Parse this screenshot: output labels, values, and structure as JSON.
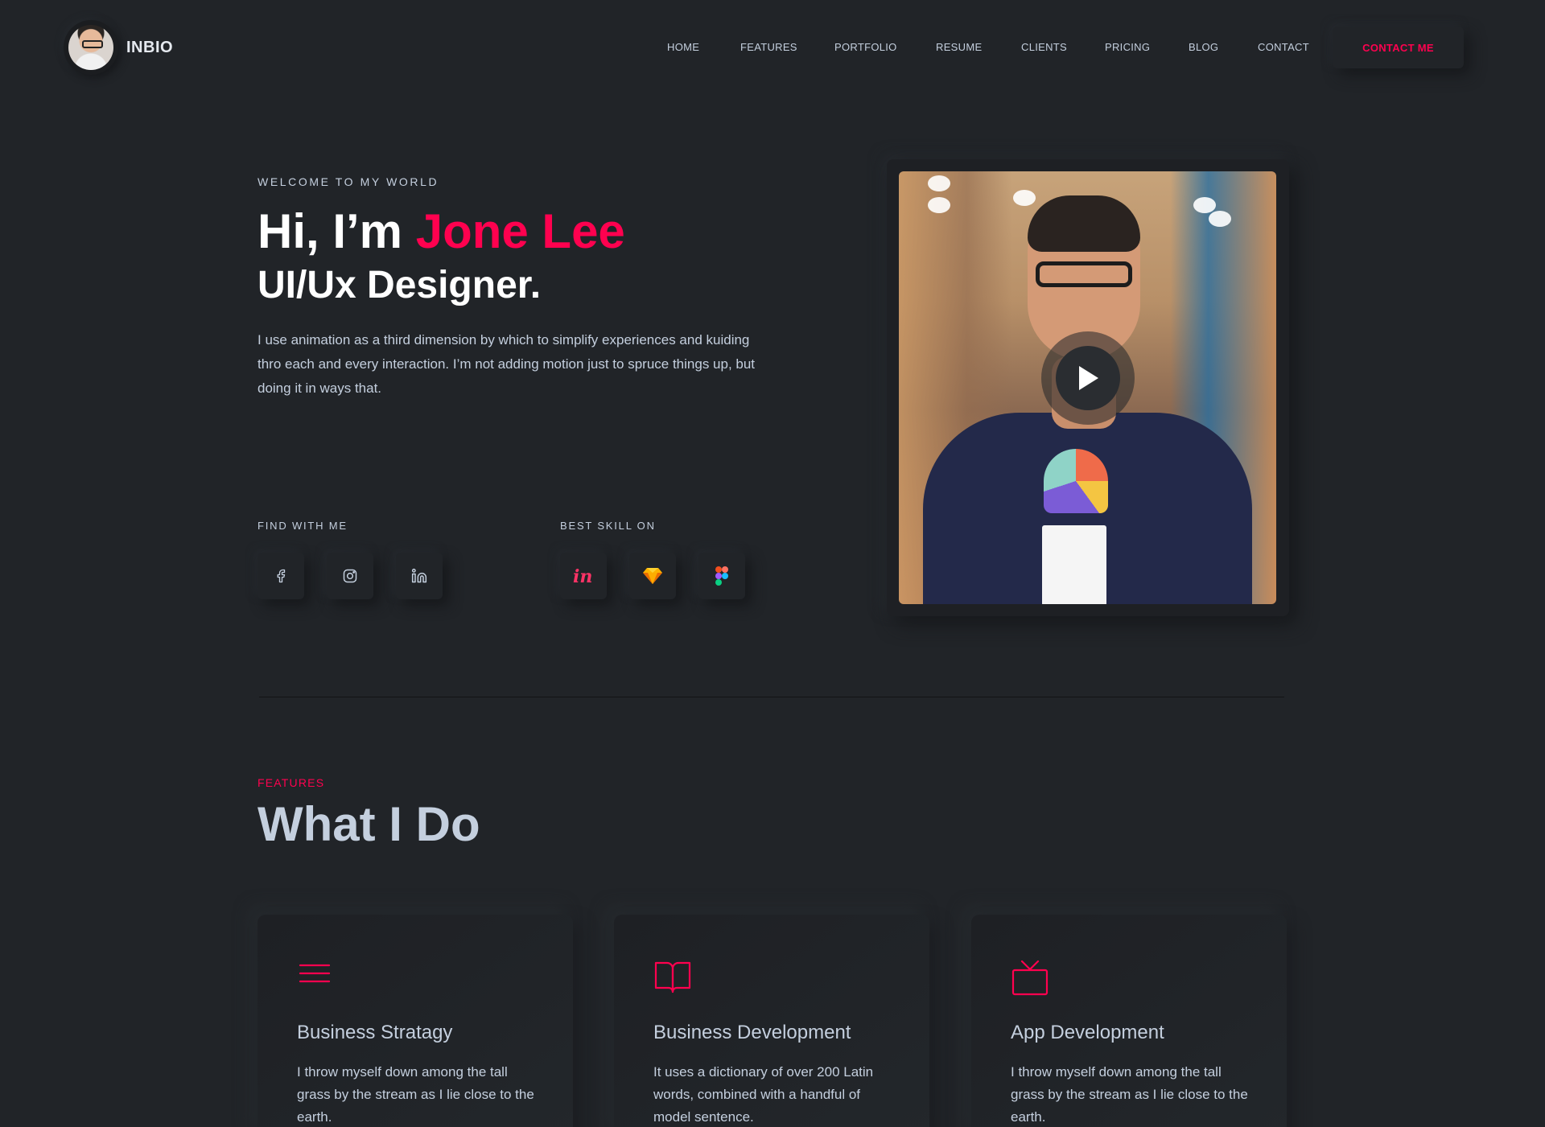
{
  "brand": {
    "name": "INBIO",
    "avatar_icon": "user-avatar"
  },
  "nav": {
    "items": [
      "HOME",
      "FEATURES",
      "PORTFOLIO",
      "RESUME",
      "CLIENTS",
      "PRICING",
      "BLOG",
      "CONTACT"
    ],
    "cta_label": "CONTACT ME"
  },
  "hero": {
    "eyebrow": "WELCOME TO MY WORLD",
    "greeting": "Hi, I’m ",
    "name": "Jone Lee",
    "role": "UI/Ux Designer.",
    "description": "I use animation as a third dimension by which to simplify experiences and kuiding thro each and every interaction. I’m not adding motion just to spruce things up, but doing it in ways that.",
    "find_label": "FIND WITH ME",
    "social_icons": [
      "facebook-icon",
      "instagram-icon",
      "linkedin-icon"
    ],
    "skill_label": "BEST SKILL ON",
    "skill_icons": [
      "invision-icon",
      "sketch-icon",
      "figma-icon"
    ]
  },
  "features": {
    "tag": "FEATURES",
    "title": "What I Do",
    "cards": [
      {
        "icon": "menu-icon",
        "title": "Business Stratagy",
        "text": "I throw myself down among the tall grass by the stream as I lie close to the earth."
      },
      {
        "icon": "book-icon",
        "title": "Business Development",
        "text": "It uses a dictionary of over 200 Latin words, combined with a handful of model sentence."
      },
      {
        "icon": "tv-icon",
        "title": "App Development",
        "text": "I throw myself down among the tall grass by the stream as I lie close to the earth."
      }
    ]
  },
  "colors": {
    "background": "#212428",
    "accent": "#ff014f",
    "text": "#c4cfde"
  }
}
